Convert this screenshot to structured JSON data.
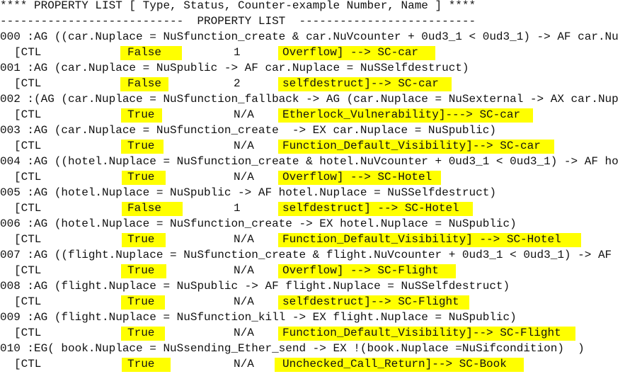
{
  "header": {
    "title": "**** PROPERTY LIST [ Type, Status, Counter-example Number, Name ] ****",
    "subtitle": "---------------------------  PROPERTY LIST  --------------------------"
  },
  "highlight_color": "#ffff00",
  "properties": [
    {
      "formula": "000 :AG ((car.Nuplace = NuSfunction_create & car.NuVcounter + 0ud3_1 < 0ud3_1) -> AF car.Nu",
      "type": "[CTL",
      "status": "False",
      "counter": "1",
      "name": "Overflow] --> SC-car"
    },
    {
      "formula": "001 :AG (car.Nuplace = NuSpublic -> AF car.Nuplace = NuSSelfdestruct)",
      "type": "[CTL",
      "status": "False",
      "counter": "2",
      "name": "selfdestruct]--> SC-car"
    },
    {
      "formula": "002 :(AG (car.Nuplace = NuSfunction_fallback -> AG (car.Nuplace = NuSexternal -> AX car.Nup",
      "type": "[CTL",
      "status": "True",
      "counter": "N/A",
      "name": "Etherlock_Vulnerability]---> SC-car"
    },
    {
      "formula": "003 :AG (car.Nuplace = NuSfunction_create  -> EX car.Nuplace = NuSpublic)",
      "type": "[CTL",
      "status": "True",
      "counter": "N/A",
      "name": "Function_Default_Visibility]--> SC-car"
    },
    {
      "formula": "004 :AG ((hotel.Nuplace = NuSfunction_create & hotel.NuVcounter + 0ud3_1 < 0ud3_1) -> AF ho",
      "type": "[CTL",
      "status": "True",
      "counter": "N/A",
      "name": "Overflow] --> SC-Hotel"
    },
    {
      "formula": "005 :AG (hotel.Nuplace = NuSpublic -> AF hotel.Nuplace = NuSSelfdestruct)",
      "type": "[CTL",
      "status": "False",
      "counter": "1",
      "name": "selfdestruct] --> SC-Hotel"
    },
    {
      "formula": "006 :AG (hotel.Nuplace = NuSfunction_create -> EX hotel.Nuplace = NuSpublic)",
      "type": "[CTL",
      "status": "True",
      "counter": "N/A",
      "name": "Function_Default_Visibility] --> SC-Hotel"
    },
    {
      "formula": "007 :AG ((flight.Nuplace = NuSfunction_create & flight.NuVcounter + 0ud3_1 < 0ud3_1) -> AF",
      "type": "[CTL",
      "status": "True",
      "counter": "N/A",
      "name": "Overflow] --> SC-Flight"
    },
    {
      "formula": "008 :AG (flight.Nuplace = NuSpublic -> AF flight.Nuplace = NuSSelfdestruct)",
      "type": "[CTL",
      "status": "True",
      "counter": "N/A",
      "name": "selfdestruct]--> SC-Flight"
    },
    {
      "formula": "009 :AG (flight.Nuplace = NuSfunction_kill -> EX flight.Nuplace = NuSpublic)",
      "type": "[CTL",
      "status": "True",
      "counter": "N/A",
      "name": "Function_Default_Visibility]--> SC-Flight"
    },
    {
      "formula": "010 :EG( book.Nuplace = NuSsending_Ether_send -> EX !(book.Nuplace =NuSifcondition)  )",
      "type": "[CTL",
      "status": "True",
      "counter": "N/A",
      "name": "Unchecked_Call_Return]--> SC-Book"
    }
  ]
}
